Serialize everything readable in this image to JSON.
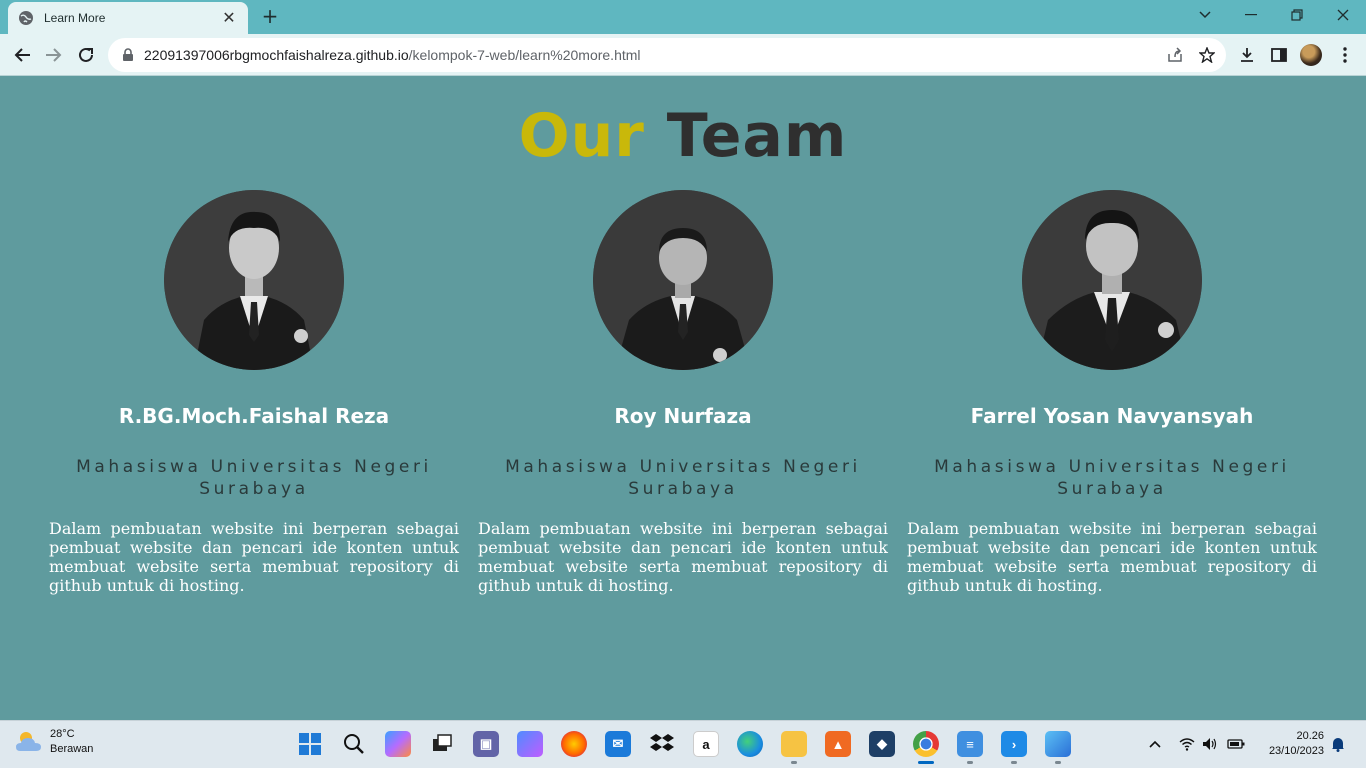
{
  "browser": {
    "tab_title": "Learn More",
    "url_host": "22091397006rbgmochfaishalreza.github.io",
    "url_path": "/kelompok-7-web/learn%20more.html"
  },
  "page": {
    "heading_accent": "Our",
    "heading_rest": "Team",
    "members": [
      {
        "name": "R.BG.Moch.Faishal Reza",
        "role": "Mahasiswa Universitas Negeri Surabaya",
        "description": "Dalam pembuatan website ini berperan sebagai pembuat website dan pencari ide konten untuk membuat website serta membuat repository di github untuk di hosting."
      },
      {
        "name": "Roy Nurfaza",
        "role": "Mahasiswa Universitas Negeri Surabaya",
        "description": "Dalam pembuatan website ini berperan sebagai pembuat website dan pencari ide konten untuk membuat website serta membuat repository di github untuk di hosting."
      },
      {
        "name": "Farrel Yosan Navyansyah",
        "role": "Mahasiswa Universitas Negeri Surabaya",
        "description": "Dalam pembuatan website ini berperan sebagai pembuat website dan pencari ide konten untuk membuat website serta membuat repository di github untuk di hosting."
      }
    ]
  },
  "taskbar": {
    "weather_temp": "28°C",
    "weather_desc": "Berawan",
    "time": "20.26",
    "date": "23/10/2023"
  },
  "colors": {
    "page_bg": "#5f9b9e",
    "heading_accent": "#c9b80a",
    "heading_rest": "#2f2f2f",
    "tabbar_bg": "#5fb7c0"
  }
}
